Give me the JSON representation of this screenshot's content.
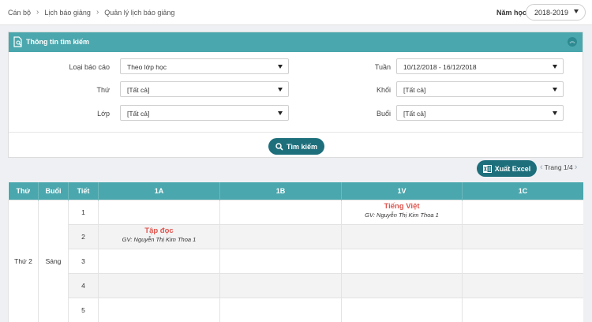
{
  "breadcrumb": [
    "Cán bộ",
    "Lịch báo giảng",
    "Quản lý lịch báo giảng"
  ],
  "year": {
    "label": "Năm học",
    "value": "2018-2019"
  },
  "search_panel": {
    "title": "Thông tin tìm kiếm",
    "fields": {
      "loai_bao_cao": {
        "label": "Loại báo cáo",
        "value": "Theo lớp học"
      },
      "thu": {
        "label": "Thứ",
        "value": "[Tất cả]"
      },
      "lop": {
        "label": "Lớp",
        "value": "[Tất cả]"
      },
      "tuan": {
        "label": "Tuần",
        "value": "10/12/2018 - 16/12/2018"
      },
      "khoi": {
        "label": "Khối",
        "value": "[Tất cả]"
      },
      "buoi": {
        "label": "Buổi",
        "value": "[Tất cả]"
      }
    },
    "search_button": "Tìm kiếm"
  },
  "export_button": "Xuất Excel",
  "pager": {
    "text": "Trang 1/4"
  },
  "table": {
    "headers": [
      "Thứ",
      "Buổi",
      "Tiết",
      "1A",
      "1B",
      "1V",
      "1C"
    ],
    "day": "Thứ 2",
    "session": "Sáng",
    "periods": [
      "1",
      "2",
      "3",
      "4",
      "5"
    ],
    "lessons": {
      "p1_1V": {
        "subject": "Tiếng Việt",
        "teacher": "GV: Nguyễn Thị Kim Thoa 1"
      },
      "p2_1A": {
        "subject": "Tập đọc",
        "teacher": "GV: Nguyễn Thị Kim Thoa 1"
      }
    }
  },
  "colors": {
    "header_teal": "#4aa7ad",
    "button_teal": "#1d6f7c",
    "subject_red": "#e0554f"
  }
}
